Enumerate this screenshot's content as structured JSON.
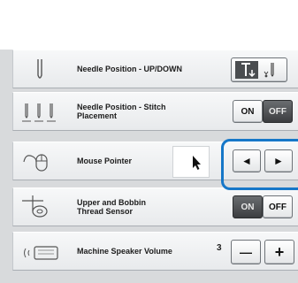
{
  "settings": {
    "rows": [
      {
        "label": "Needle Position - UP/DOWN",
        "icon": "needle-icon"
      },
      {
        "label": "Needle Position - Stitch Placement",
        "icon": "needle-stitch-placement-icon",
        "toggle": {
          "on": "ON",
          "off": "OFF",
          "selected": "OFF"
        }
      },
      {
        "label": "Mouse Pointer",
        "icon": "mouse-icon",
        "left": "◄",
        "right": "►"
      },
      {
        "label": "Upper and Bobbin Thread Sensor",
        "icon": "thread-sensor-icon",
        "toggle": {
          "on": "ON",
          "off": "OFF",
          "selected": "ON"
        }
      },
      {
        "label": "Machine Speaker Volume",
        "icon": "speaker-icon",
        "value": "3",
        "minus": "—",
        "plus": "+"
      }
    ]
  },
  "colors": {
    "highlight": "#1677c8",
    "panel": "#d8dadc"
  }
}
